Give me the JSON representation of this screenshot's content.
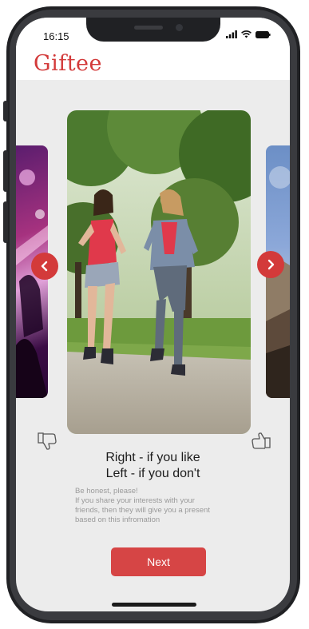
{
  "status": {
    "time": "16:15"
  },
  "app": {
    "logo": "Giftee"
  },
  "prompt": {
    "line1": "Right - if you like",
    "line2": "Left - if you don't"
  },
  "hint": {
    "line1": "Be honest, please!",
    "line2": "If you share your interests with your",
    "line3": "friends, then they will give you a present",
    "line4": "based on this infromation"
  },
  "actions": {
    "next_label": "Next"
  },
  "colors": {
    "brand": "#d33a3a",
    "button": "#d64545",
    "background": "#ececec"
  },
  "icons": {
    "prev": "chevron-left-icon",
    "next": "chevron-right-icon",
    "dislike": "thumbs-down-icon",
    "like": "thumbs-up-icon"
  },
  "cards": [
    {
      "position": "left",
      "subject": "concert-crowd"
    },
    {
      "position": "center",
      "subject": "two-women-jogging-in-park"
    },
    {
      "position": "right",
      "subject": "mountain-landscape"
    }
  ]
}
